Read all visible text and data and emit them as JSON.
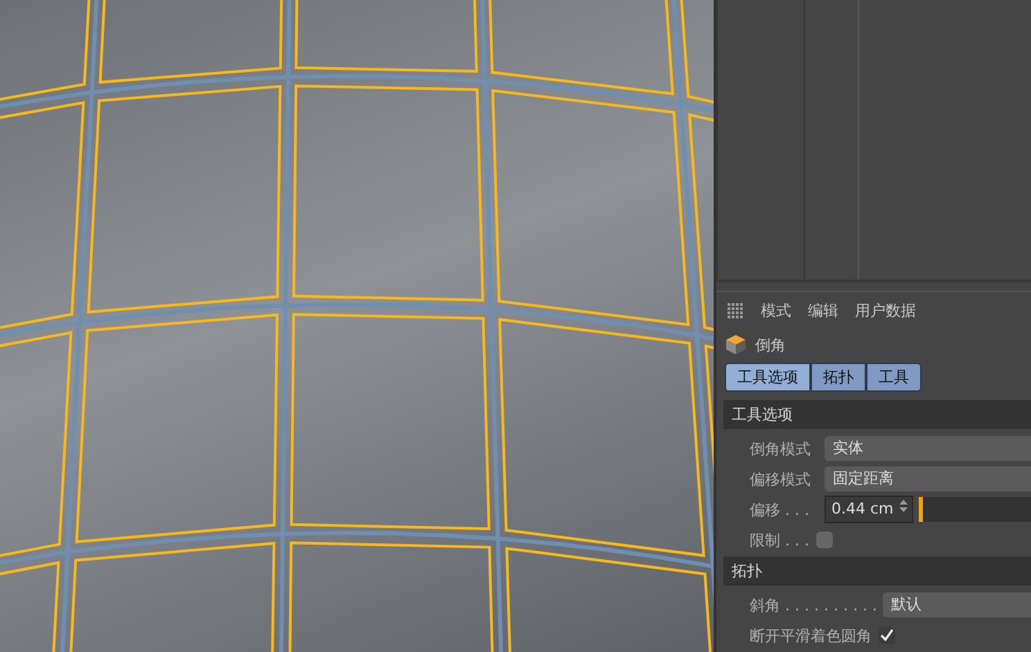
{
  "attribute_menu": [
    "模式",
    "编辑",
    "用户数据"
  ],
  "tool": {
    "title": "倒角"
  },
  "tabs": [
    {
      "label": "工具选项",
      "selected": true
    },
    {
      "label": "拓扑",
      "selected": false
    },
    {
      "label": "工具",
      "selected": false
    }
  ],
  "sections": [
    {
      "title": "工具选项",
      "rows": [
        {
          "kind": "dropdown",
          "label": "倒角模式",
          "value": "实体"
        },
        {
          "kind": "dropdown",
          "label": "偏移模式",
          "value": "固定距离"
        },
        {
          "kind": "number",
          "label": "偏移 . . .",
          "value": "0.44 cm",
          "level": 0.01
        },
        {
          "kind": "checkbox",
          "label": "限制 . . .",
          "checked": false
        }
      ]
    },
    {
      "title": "拓扑",
      "rows": [
        {
          "kind": "dropdown",
          "label": "斜角 . . . . . . . . . .",
          "value": "默认",
          "wide": true
        },
        {
          "kind": "checkbox",
          "label": "断开平滑着色圆角",
          "checked": true
        }
      ]
    }
  ]
}
